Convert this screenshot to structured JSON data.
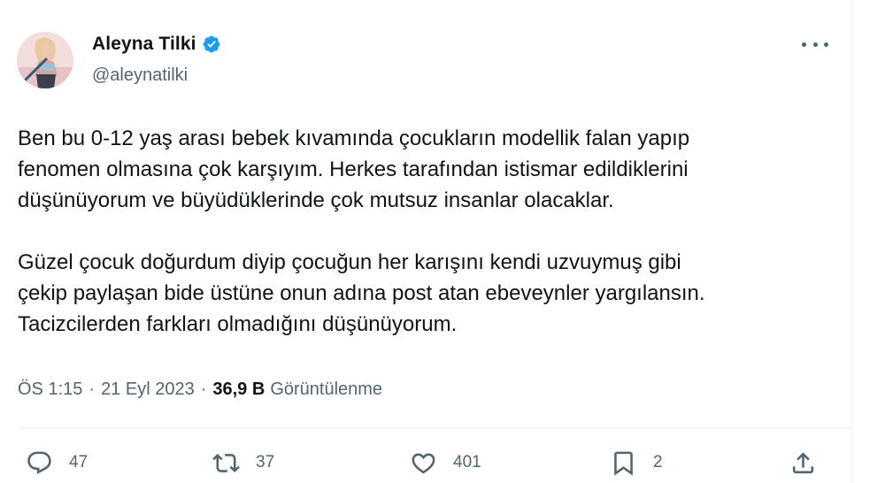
{
  "author": {
    "display_name": "Aleyna Tilki",
    "handle": "@aleynatilki",
    "verified": true
  },
  "tweet": {
    "paragraphs": [
      [
        "Ben bu 0-12 yaş arası bebek kıvamında çocukların modellik falan yapıp",
        "fenomen olmasına çok karşıyım. Herkes tarafından istismar edildiklerini",
        "düşünüyorum ve büyüdüklerinde çok mutsuz insanlar olacaklar."
      ],
      [
        "Güzel çocuk doğurdum diyip çocuğun her  karışını kendi uzvuymuş gibi",
        "çekip paylaşan bide üstüne onun adına post atan ebeveynler yargılansın.",
        "Tacizcilerden farkları olmadığını düşünüyorum."
      ]
    ]
  },
  "meta": {
    "time": "ÖS 1:15",
    "separator": "·",
    "date": "21 Eyl 2023",
    "views_count": "36,9 B",
    "views_label": "Görüntülenme"
  },
  "actions": {
    "replies": "47",
    "reposts": "37",
    "likes": "401",
    "bookmarks": "2"
  },
  "icons": [
    "verified-badge-icon",
    "more-icon",
    "reply-icon",
    "repost-icon",
    "like-icon",
    "bookmark-icon",
    "share-icon"
  ],
  "colors": {
    "text_primary": "#0f1419",
    "text_secondary": "#536471",
    "verified_blue": "#1d9bf0",
    "divider": "#eff3f4"
  }
}
